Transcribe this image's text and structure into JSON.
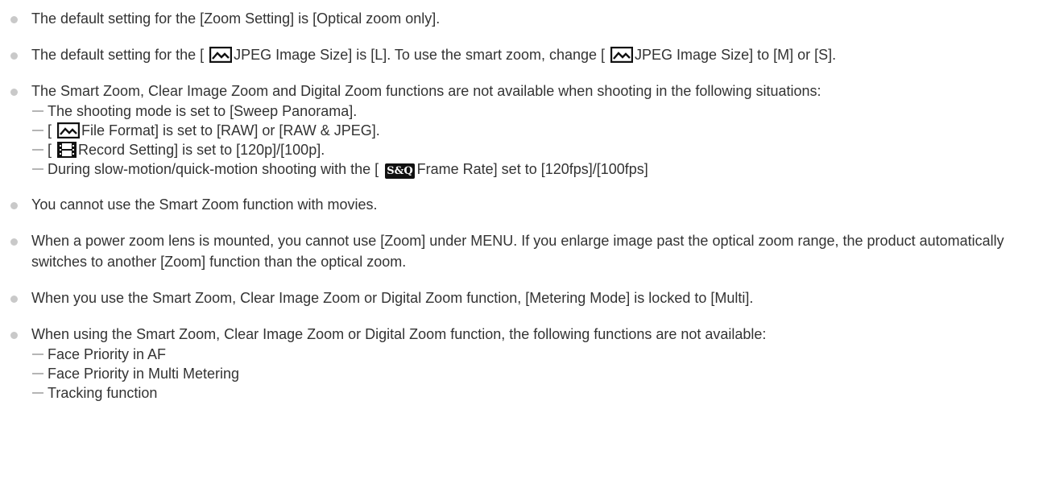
{
  "notes": [
    {
      "text": "The default setting for the [Zoom Setting] is [Optical zoom only]."
    },
    {
      "part1": "The default setting for the [ ",
      "icon": "still-image-icon",
      "part2": "JPEG Image Size] is [L]. To use the smart zoom, change [ ",
      "icon2": "still-image-icon",
      "part3": "JPEG Image Size] to [M] or [S]."
    },
    {
      "text": "The Smart Zoom, Clear Image Zoom and Digital Zoom functions are not available when shooting in the following situations:",
      "items": [
        {
          "text": "The shooting mode is set to [Sweep Panorama]."
        },
        {
          "pre": "[ ",
          "icon": "still-image-icon",
          "post": "File Format] is set to [RAW] or [RAW & JPEG]."
        },
        {
          "pre": "[ ",
          "icon": "movie-film-icon",
          "post": "Record Setting] is set to [120p]/[100p]."
        },
        {
          "pre": "During slow-motion/quick-motion shooting with the [ ",
          "badge": "S&Q",
          "post": "Frame Rate] set to [120fps]/[100fps]"
        }
      ]
    },
    {
      "text": "You cannot use the Smart Zoom function with movies."
    },
    {
      "text": "When a power zoom lens is mounted, you cannot use [Zoom] under MENU. If you enlarge image past the optical zoom range, the product automatically switches to another [Zoom] function than the optical zoom."
    },
    {
      "text": "When you use the Smart Zoom, Clear Image Zoom or Digital Zoom function, [Metering Mode] is locked to [Multi]."
    },
    {
      "text": "When using the Smart Zoom, Clear Image Zoom or Digital Zoom function, the following functions are not available:",
      "items": [
        {
          "text": "Face Priority in AF"
        },
        {
          "text": "Face Priority in Multi Metering"
        },
        {
          "text": "Tracking function"
        }
      ]
    }
  ]
}
